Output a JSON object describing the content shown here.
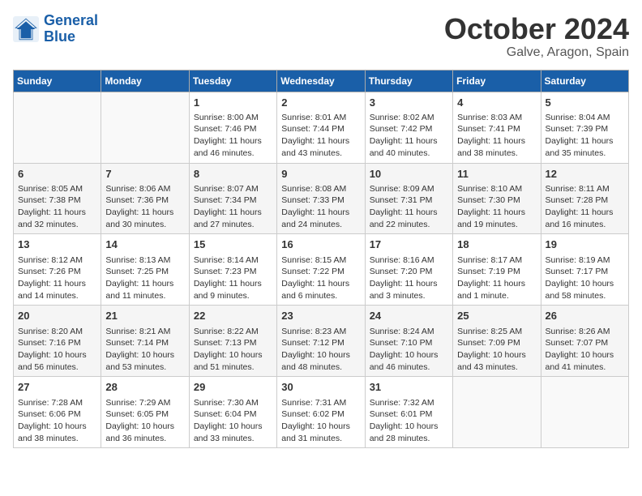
{
  "logo": {
    "line1": "General",
    "line2": "Blue"
  },
  "title": "October 2024",
  "subtitle": "Galve, Aragon, Spain",
  "weekdays": [
    "Sunday",
    "Monday",
    "Tuesday",
    "Wednesday",
    "Thursday",
    "Friday",
    "Saturday"
  ],
  "weeks": [
    [
      {
        "day": "",
        "info": ""
      },
      {
        "day": "",
        "info": ""
      },
      {
        "day": "1",
        "info": "Sunrise: 8:00 AM\nSunset: 7:46 PM\nDaylight: 11 hours and 46 minutes."
      },
      {
        "day": "2",
        "info": "Sunrise: 8:01 AM\nSunset: 7:44 PM\nDaylight: 11 hours and 43 minutes."
      },
      {
        "day": "3",
        "info": "Sunrise: 8:02 AM\nSunset: 7:42 PM\nDaylight: 11 hours and 40 minutes."
      },
      {
        "day": "4",
        "info": "Sunrise: 8:03 AM\nSunset: 7:41 PM\nDaylight: 11 hours and 38 minutes."
      },
      {
        "day": "5",
        "info": "Sunrise: 8:04 AM\nSunset: 7:39 PM\nDaylight: 11 hours and 35 minutes."
      }
    ],
    [
      {
        "day": "6",
        "info": "Sunrise: 8:05 AM\nSunset: 7:38 PM\nDaylight: 11 hours and 32 minutes."
      },
      {
        "day": "7",
        "info": "Sunrise: 8:06 AM\nSunset: 7:36 PM\nDaylight: 11 hours and 30 minutes."
      },
      {
        "day": "8",
        "info": "Sunrise: 8:07 AM\nSunset: 7:34 PM\nDaylight: 11 hours and 27 minutes."
      },
      {
        "day": "9",
        "info": "Sunrise: 8:08 AM\nSunset: 7:33 PM\nDaylight: 11 hours and 24 minutes."
      },
      {
        "day": "10",
        "info": "Sunrise: 8:09 AM\nSunset: 7:31 PM\nDaylight: 11 hours and 22 minutes."
      },
      {
        "day": "11",
        "info": "Sunrise: 8:10 AM\nSunset: 7:30 PM\nDaylight: 11 hours and 19 minutes."
      },
      {
        "day": "12",
        "info": "Sunrise: 8:11 AM\nSunset: 7:28 PM\nDaylight: 11 hours and 16 minutes."
      }
    ],
    [
      {
        "day": "13",
        "info": "Sunrise: 8:12 AM\nSunset: 7:26 PM\nDaylight: 11 hours and 14 minutes."
      },
      {
        "day": "14",
        "info": "Sunrise: 8:13 AM\nSunset: 7:25 PM\nDaylight: 11 hours and 11 minutes."
      },
      {
        "day": "15",
        "info": "Sunrise: 8:14 AM\nSunset: 7:23 PM\nDaylight: 11 hours and 9 minutes."
      },
      {
        "day": "16",
        "info": "Sunrise: 8:15 AM\nSunset: 7:22 PM\nDaylight: 11 hours and 6 minutes."
      },
      {
        "day": "17",
        "info": "Sunrise: 8:16 AM\nSunset: 7:20 PM\nDaylight: 11 hours and 3 minutes."
      },
      {
        "day": "18",
        "info": "Sunrise: 8:17 AM\nSunset: 7:19 PM\nDaylight: 11 hours and 1 minute."
      },
      {
        "day": "19",
        "info": "Sunrise: 8:19 AM\nSunset: 7:17 PM\nDaylight: 10 hours and 58 minutes."
      }
    ],
    [
      {
        "day": "20",
        "info": "Sunrise: 8:20 AM\nSunset: 7:16 PM\nDaylight: 10 hours and 56 minutes."
      },
      {
        "day": "21",
        "info": "Sunrise: 8:21 AM\nSunset: 7:14 PM\nDaylight: 10 hours and 53 minutes."
      },
      {
        "day": "22",
        "info": "Sunrise: 8:22 AM\nSunset: 7:13 PM\nDaylight: 10 hours and 51 minutes."
      },
      {
        "day": "23",
        "info": "Sunrise: 8:23 AM\nSunset: 7:12 PM\nDaylight: 10 hours and 48 minutes."
      },
      {
        "day": "24",
        "info": "Sunrise: 8:24 AM\nSunset: 7:10 PM\nDaylight: 10 hours and 46 minutes."
      },
      {
        "day": "25",
        "info": "Sunrise: 8:25 AM\nSunset: 7:09 PM\nDaylight: 10 hours and 43 minutes."
      },
      {
        "day": "26",
        "info": "Sunrise: 8:26 AM\nSunset: 7:07 PM\nDaylight: 10 hours and 41 minutes."
      }
    ],
    [
      {
        "day": "27",
        "info": "Sunrise: 7:28 AM\nSunset: 6:06 PM\nDaylight: 10 hours and 38 minutes."
      },
      {
        "day": "28",
        "info": "Sunrise: 7:29 AM\nSunset: 6:05 PM\nDaylight: 10 hours and 36 minutes."
      },
      {
        "day": "29",
        "info": "Sunrise: 7:30 AM\nSunset: 6:04 PM\nDaylight: 10 hours and 33 minutes."
      },
      {
        "day": "30",
        "info": "Sunrise: 7:31 AM\nSunset: 6:02 PM\nDaylight: 10 hours and 31 minutes."
      },
      {
        "day": "31",
        "info": "Sunrise: 7:32 AM\nSunset: 6:01 PM\nDaylight: 10 hours and 28 minutes."
      },
      {
        "day": "",
        "info": ""
      },
      {
        "day": "",
        "info": ""
      }
    ]
  ]
}
